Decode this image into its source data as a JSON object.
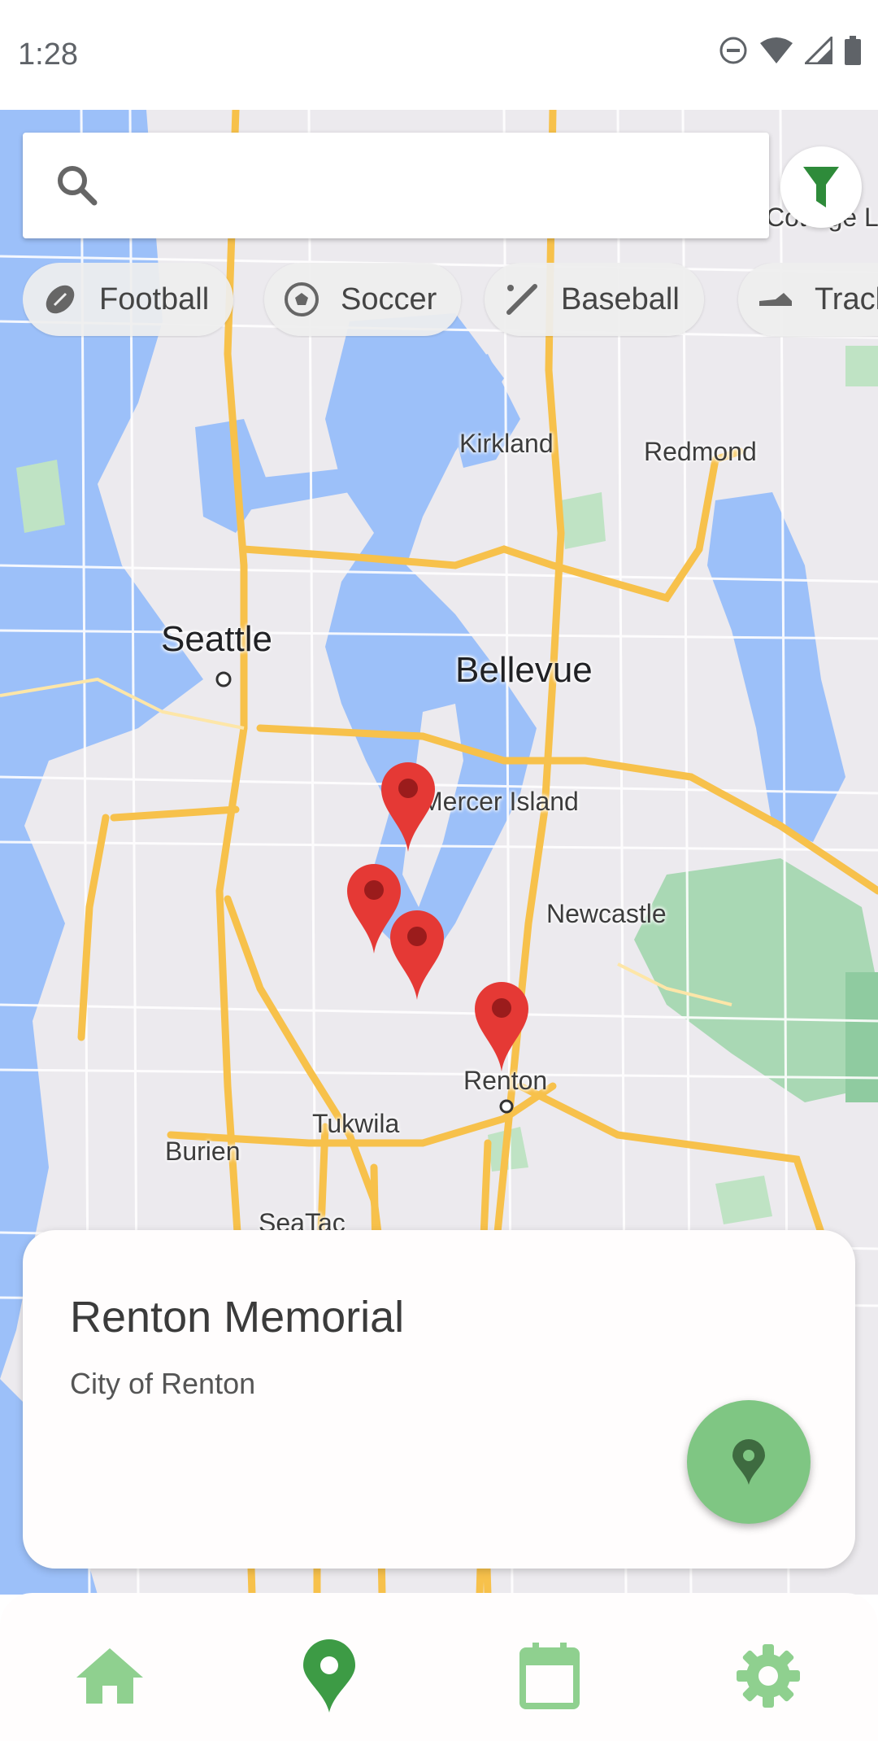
{
  "status_bar": {
    "time": "1:28",
    "icons": [
      "do-not-disturb-icon",
      "wifi-icon",
      "signal-icon",
      "battery-icon"
    ]
  },
  "search": {
    "value": "",
    "placeholder": "",
    "icon": "search-icon"
  },
  "filter_button": {
    "icon": "filter-icon",
    "color": "#2e8b3a"
  },
  "chips": [
    {
      "label": "Football",
      "icon": "football-icon"
    },
    {
      "label": "Soccer",
      "icon": "soccer-ball-icon"
    },
    {
      "label": "Baseball",
      "icon": "baseball-bat-icon"
    },
    {
      "label": "Track",
      "icon": "track-shoe-icon"
    }
  ],
  "map": {
    "place_labels": {
      "kirkland": "Kirkland",
      "redmond": "Redmond",
      "seattle": "Seattle",
      "bellevue": "Bellevue",
      "mercer_island": "Mercer Island",
      "newcastle": "Newcastle",
      "renton": "Renton",
      "tukwila": "Tukwila",
      "burien": "Burien",
      "seatac": "SeaTac",
      "cottage_lake": "Cottage Lake"
    },
    "marker_color": "#e53935",
    "marker_count": 4
  },
  "selected_location": {
    "name": "Renton Memorial",
    "owner": "City of Renton"
  },
  "fab": {
    "icon": "location-pin-icon",
    "color": "#7fc683"
  },
  "bottom_nav": {
    "items": [
      {
        "icon": "home-icon",
        "active": false
      },
      {
        "icon": "location-pin-icon",
        "active": true
      },
      {
        "icon": "calendar-icon",
        "active": false
      },
      {
        "icon": "gear-icon",
        "active": false
      }
    ],
    "active_color": "#3d9b45",
    "inactive_color": "#8fd08f"
  }
}
